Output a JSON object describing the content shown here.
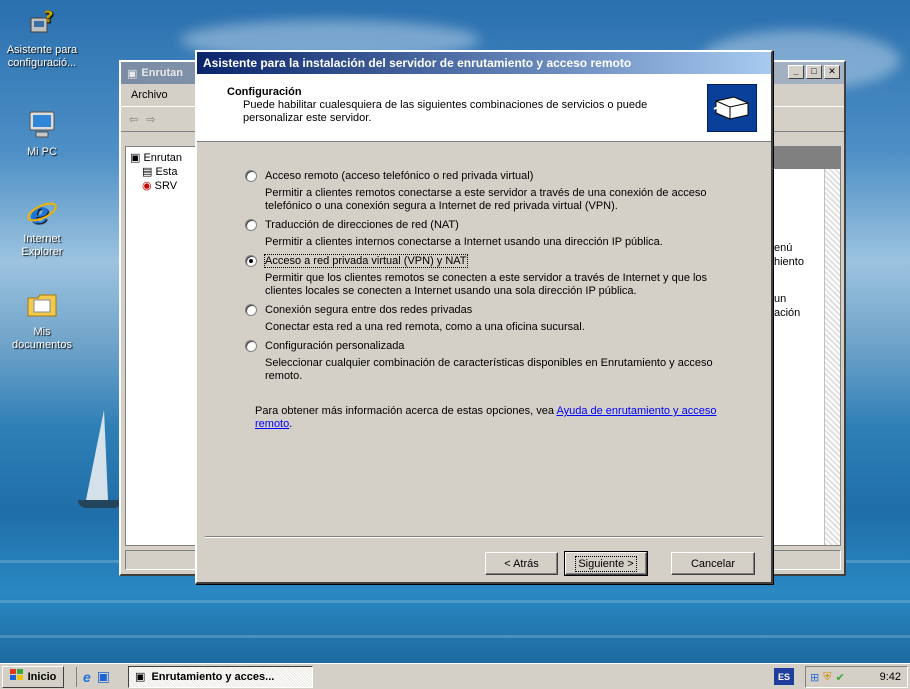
{
  "desktop": {
    "icons": [
      {
        "name": "Asistente para configuració...",
        "icon": "config-wizard-icon"
      },
      {
        "name": "Mi PC",
        "icon": "computer-icon"
      },
      {
        "name": "Internet Explorer",
        "icon": "internet-explorer-icon"
      },
      {
        "name": "Mis documentos",
        "icon": "documents-folder-icon"
      }
    ]
  },
  "background_window": {
    "title": "Enrutan",
    "menu": [
      "Archivo"
    ],
    "tree": [
      "Enrutan",
      "Esta",
      "SRV"
    ],
    "right_text": [
      "enú",
      "hiento",
      "un",
      "ación"
    ]
  },
  "wizard": {
    "title": "Asistente para la instalación del servidor de enrutamiento y acceso remoto",
    "header_title": "Configuración",
    "header_subtitle": "Puede habilitar cualesquiera de las siguientes combinaciones de servicios o puede personalizar este servidor.",
    "options": [
      {
        "label": "Acceso remoto (acceso telefónico o red privada virtual)",
        "description": "Permitir a clientes remotos conectarse a este servidor a través de una conexión de acceso telefónico o una conexión segura a Internet de red privada virtual (VPN).",
        "selected": false
      },
      {
        "label": "Traducción de direcciones de red (NAT)",
        "description": "Permitir a clientes internos conectarse a Internet usando una dirección IP pública.",
        "selected": false
      },
      {
        "label": "Acceso a red privada virtual (VPN) y NAT",
        "description": "Permitir que los clientes remotos se conecten a este servidor a través de Internet y que los clientes locales se conecten a Internet usando una sola dirección IP pública.",
        "selected": true
      },
      {
        "label": "Conexión segura entre dos redes privadas",
        "description": "Conectar esta red a una red remota, como a una oficina sucursal.",
        "selected": false
      },
      {
        "label": "Configuración personalizada",
        "description": "Seleccionar cualquier combinación de características disponibles en Enrutamiento y acceso remoto.",
        "selected": false
      }
    ],
    "more_info_text": "Para obtener más información acerca de estas opciones, vea ",
    "more_info_link": "Ayuda de enrutamiento y acceso remoto",
    "more_info_end": ".",
    "buttons": {
      "back": "< Atrás",
      "next": "Siguiente >",
      "cancel": "Cancelar"
    }
  },
  "taskbar": {
    "start_label": "Inicio",
    "task_label": "Enrutamiento y acces...",
    "language": "ES",
    "clock": "9:42"
  },
  "colors": {
    "title_active_start": "#0a246a",
    "title_active_end": "#a6caf0",
    "face": "#d4d0c8",
    "link": "#0000ff"
  }
}
